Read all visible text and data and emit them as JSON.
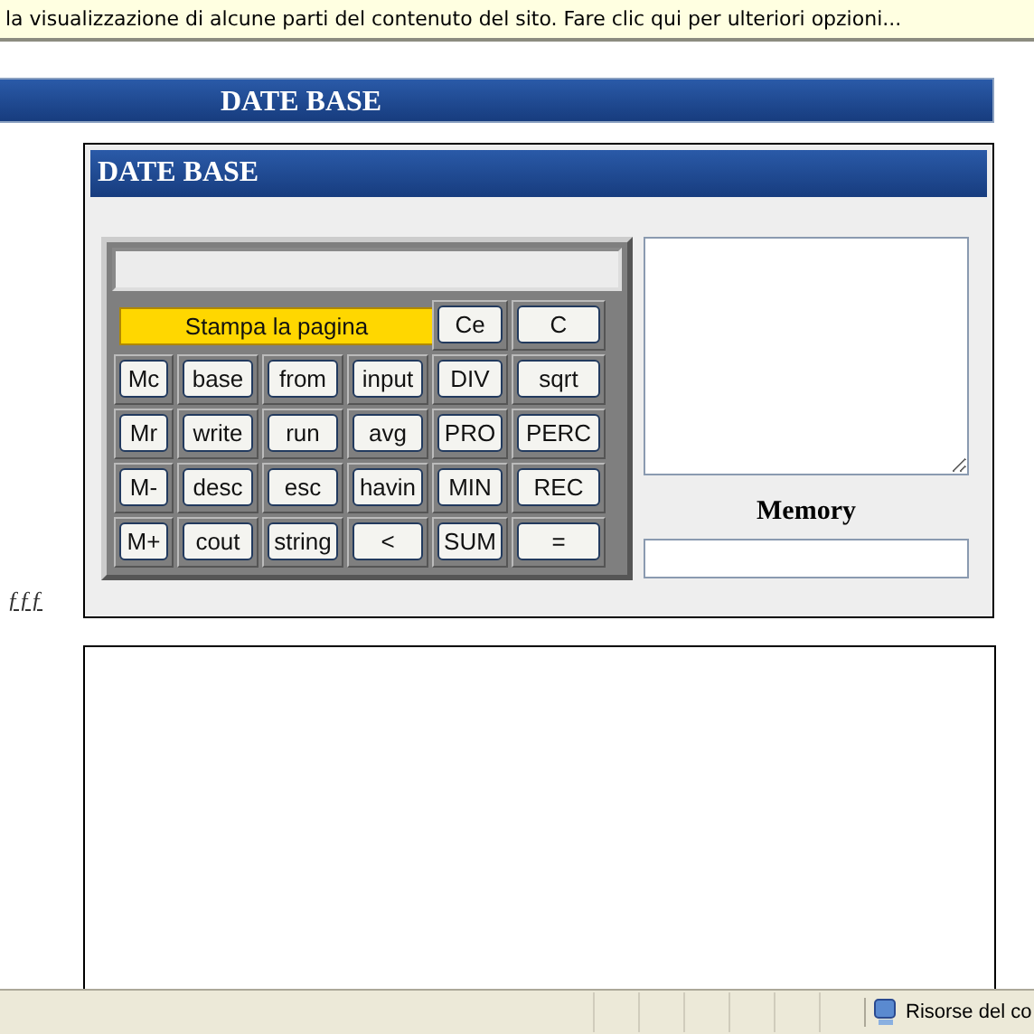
{
  "info_bar": {
    "text": "la visualizzazione di alcune parti del contenuto del sito. Fare clic qui per ulteriori opzioni..."
  },
  "page_header": {
    "title": "DATE BASE"
  },
  "side_link": {
    "text": "ƒƒƒ"
  },
  "panel": {
    "title": "DATE BASE",
    "calculator": {
      "print_button": "Stampa la pagina",
      "top_keys": [
        {
          "label": "Ce",
          "kind": "key"
        },
        {
          "label": "C",
          "kind": "key"
        }
      ],
      "rows": [
        [
          {
            "label": "Mc",
            "kind": "key"
          },
          {
            "label": "base",
            "kind": "key"
          },
          {
            "label": "from",
            "kind": "key"
          },
          {
            "label": "input",
            "kind": "key"
          },
          {
            "label": "DIV",
            "kind": "key"
          },
          {
            "label": "sqrt",
            "kind": "key"
          }
        ],
        [
          {
            "label": "Mr",
            "kind": "key"
          },
          {
            "label": "write",
            "kind": "key"
          },
          {
            "label": "run",
            "kind": "key"
          },
          {
            "label": "avg",
            "kind": "key"
          },
          {
            "label": "PRO",
            "kind": "key"
          },
          {
            "label": "PERC",
            "kind": "key"
          }
        ],
        [
          {
            "label": "M-",
            "kind": "key"
          },
          {
            "label": "desc",
            "kind": "key"
          },
          {
            "label": "esc",
            "kind": "key"
          },
          {
            "label": "havin",
            "kind": "key"
          },
          {
            "label": "MIN",
            "kind": "key"
          },
          {
            "label": "REC",
            "kind": "key"
          }
        ],
        [
          {
            "label": "M+",
            "kind": "key"
          },
          {
            "label": "cout",
            "kind": "key"
          },
          {
            "label": "string",
            "kind": "key"
          },
          {
            "label": "<",
            "kind": "key"
          },
          {
            "label": "SUM",
            "kind": "key"
          },
          {
            "label": "=",
            "kind": "key"
          }
        ]
      ]
    },
    "memory_label": "Memory"
  },
  "status_bar": {
    "zone": "Risorse del co"
  }
}
